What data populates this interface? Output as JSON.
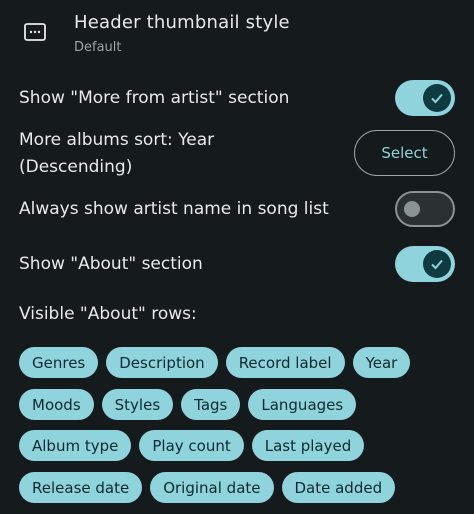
{
  "header": {
    "title": "Header thumbnail style",
    "subtitle": "Default",
    "icon": "picture-icon"
  },
  "settings": {
    "more_from_artist": {
      "label": "Show \"More from artist\" section",
      "enabled": true
    },
    "albums_sort": {
      "label_line1": "More albums sort: Year",
      "label_line2": "(Descending)",
      "button_label": "Select"
    },
    "always_artist_name": {
      "label": "Always show artist name in song list",
      "enabled": false
    },
    "show_about": {
      "label": "Show \"About\" section",
      "enabled": true
    },
    "visible_about_rows": {
      "label": "Visible \"About\" rows:"
    }
  },
  "chips": {
    "row1": [
      "Genres",
      "Description",
      "Record label",
      "Year"
    ],
    "row2": [
      "Moods",
      "Styles",
      "Tags",
      "Languages"
    ],
    "row3": [
      "Album type",
      "Play count",
      "Last played"
    ],
    "row4": [
      "Release date",
      "Original date",
      "Date added"
    ]
  },
  "colors": {
    "background": "#151a1c",
    "accent": "#8fd3dd",
    "toggle_thumb_on": "#0f3a40"
  }
}
